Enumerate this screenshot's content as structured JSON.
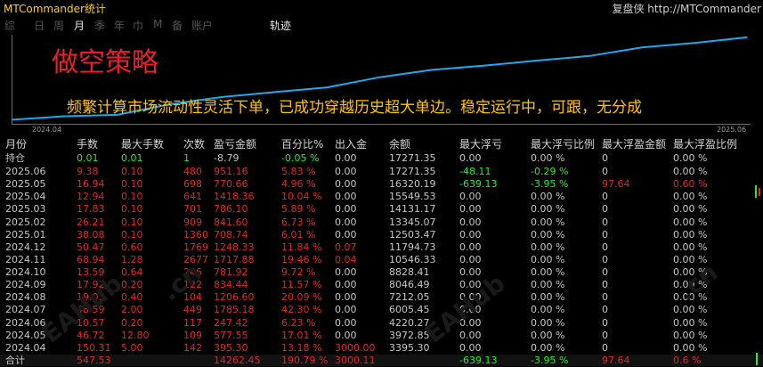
{
  "window": {
    "title": "MTCommander统计",
    "top_right": "复盘侠 http://MTCommander"
  },
  "tabs": [
    {
      "label": "综",
      "active": false
    },
    {
      "label": "日",
      "active": false
    },
    {
      "label": "周",
      "active": false
    },
    {
      "label": "月",
      "active": true
    },
    {
      "label": "季",
      "active": false
    },
    {
      "label": "年",
      "active": false
    },
    {
      "label": "巾",
      "active": false
    },
    {
      "label": "M",
      "active": false
    },
    {
      "label": "备",
      "active": false
    },
    {
      "label": "账户",
      "active": false
    },
    {
      "label": "轨迹",
      "active": true
    }
  ],
  "chart": {
    "heading": "做空策略",
    "subtitle": "频繁计算市场流动性灵活下单，已成功穿越历史超大单边。稳定运行中，可跟，无分成",
    "line_color": "#1ea8ee"
  },
  "chart_data": {
    "type": "line",
    "title": "",
    "x": [
      "2024.04",
      "2024.05",
      "2024.06",
      "2024.07",
      "2024.08",
      "2024.09",
      "2024.10",
      "2024.11",
      "2024.12",
      "2025.01",
      "2025.02",
      "2025.03",
      "2025.04",
      "2025.05",
      "2025.06"
    ],
    "values": [
      3395.3,
      3972.85,
      4220.27,
      6005.45,
      7212.05,
      8046.49,
      8828.41,
      10546.33,
      11794.73,
      12503.47,
      13345.07,
      14131.17,
      15549.53,
      16320.19,
      17271.35
    ],
    "x_ticks": [
      "2024.04",
      "2025.06"
    ],
    "ylim": [
      3000,
      17400
    ],
    "grid": false
  },
  "table": {
    "columns": [
      "月份",
      "手数",
      "最大手数",
      "次数",
      "盈亏金额",
      "百分比%",
      "出入金",
      "余额",
      "最大浮亏",
      "最大浮亏比例",
      "最大浮盈金额",
      "最大浮盈比例"
    ],
    "holding": {
      "period": "持仓",
      "lots": "0.01",
      "max_lots": "0.01",
      "count": "1",
      "pnl": "-8.79",
      "pct": "-0.05 %",
      "flow": "0.00",
      "balance": "17271.35",
      "max_dd": "0.00",
      "max_dd_pct": "0.00 %",
      "max_fp": "0",
      "max_fp_pct": "0.00 %"
    },
    "rows": [
      {
        "period": "2025.06",
        "lots": "9.38",
        "max_lots": "0.10",
        "count": "480",
        "pnl": "951.16",
        "pct": "5.83 %",
        "flow": "0.00",
        "balance": "17271.35",
        "max_dd": "-48.11",
        "max_dd_pct": "-0.29 %",
        "max_fp": "0",
        "max_fp_pct": "0.00 %"
      },
      {
        "period": "2025.05",
        "lots": "16.94",
        "max_lots": "0.10",
        "count": "698",
        "pnl": "770.66",
        "pct": "4.96 %",
        "flow": "0.00",
        "balance": "16320.19",
        "max_dd": "-639.13",
        "max_dd_pct": "-3.95 %",
        "max_fp": "97.64",
        "max_fp_pct": "0.60 %"
      },
      {
        "period": "2025.04",
        "lots": "12.94",
        "max_lots": "0.10",
        "count": "641",
        "pnl": "1418.36",
        "pct": "10.04 %",
        "flow": "0.00",
        "balance": "15549.53",
        "max_dd": "0.00",
        "max_dd_pct": "0.00 %",
        "max_fp": "0",
        "max_fp_pct": "0.00 %"
      },
      {
        "period": "2025.03",
        "lots": "17.83",
        "max_lots": "0.10",
        "count": "701",
        "pnl": "786.10",
        "pct": "5.89 %",
        "flow": "0.00",
        "balance": "14131.17",
        "max_dd": "0.00",
        "max_dd_pct": "0.00 %",
        "max_fp": "0",
        "max_fp_pct": "0.00 %"
      },
      {
        "period": "2025.02",
        "lots": "26.21",
        "max_lots": "0.10",
        "count": "909",
        "pnl": "841.60",
        "pct": "6.73 %",
        "flow": "0.00",
        "balance": "13345.07",
        "max_dd": "0.00",
        "max_dd_pct": "0.00 %",
        "max_fp": "0",
        "max_fp_pct": "0.00 %"
      },
      {
        "period": "2025.01",
        "lots": "38.08",
        "max_lots": "0.10",
        "count": "1360",
        "pnl": "708.74",
        "pct": "6.01 %",
        "flow": "0.00",
        "balance": "12503.47",
        "max_dd": "0.00",
        "max_dd_pct": "0.00 %",
        "max_fp": "0",
        "max_fp_pct": "0.00 %"
      },
      {
        "period": "2024.12",
        "lots": "50.47",
        "max_lots": "0.60",
        "count": "1769",
        "pnl": "1248.33",
        "pct": "11.84 %",
        "flow": "0.07",
        "balance": "11794.73",
        "max_dd": "0.00",
        "max_dd_pct": "0.00 %",
        "max_fp": "0",
        "max_fp_pct": "0.00 %"
      },
      {
        "period": "2024.11",
        "lots": "68.94",
        "max_lots": "1.28",
        "count": "2677",
        "pnl": "1717.88",
        "pct": "19.46 %",
        "flow": "0.04",
        "balance": "10546.33",
        "max_dd": "0.00",
        "max_dd_pct": "0.00 %",
        "max_fp": "0",
        "max_fp_pct": "0.00 %"
      },
      {
        "period": "2024.10",
        "lots": "13.59",
        "max_lots": "0.64",
        "count": "246",
        "pnl": "781.92",
        "pct": "9.72 %",
        "flow": "0.00",
        "balance": "8828.41",
        "max_dd": "0.00",
        "max_dd_pct": "0.00 %",
        "max_fp": "0",
        "max_fp_pct": "0.00 %"
      },
      {
        "period": "2024.09",
        "lots": "17.92",
        "max_lots": "0.20",
        "count": "122",
        "pnl": "834.44",
        "pct": "11.57 %",
        "flow": "0.00",
        "balance": "8046.49",
        "max_dd": "0.00",
        "max_dd_pct": "0.00 %",
        "max_fp": "0",
        "max_fp_pct": "0.00 %"
      },
      {
        "period": "2024.08",
        "lots": "19.03",
        "max_lots": "0.40",
        "count": "104",
        "pnl": "1206.60",
        "pct": "20.09 %",
        "flow": "0.00",
        "balance": "7212.05",
        "max_dd": "0.00",
        "max_dd_pct": "0.00 %",
        "max_fp": "0",
        "max_fp_pct": "0.00 %"
      },
      {
        "period": "2024.07",
        "lots": "48.59",
        "max_lots": "2.00",
        "count": "449",
        "pnl": "1785.18",
        "pct": "42.30 %",
        "flow": "0.00",
        "balance": "6005.45",
        "max_dd": "0.00",
        "max_dd_pct": "0.00 %",
        "max_fp": "0",
        "max_fp_pct": "0.00 %"
      },
      {
        "period": "2024.06",
        "lots": "10.57",
        "max_lots": "0.20",
        "count": "117",
        "pnl": "247.42",
        "pct": "6.23 %",
        "flow": "0.00",
        "balance": "4220.27",
        "max_dd": "0.00",
        "max_dd_pct": "0.00 %",
        "max_fp": "0",
        "max_fp_pct": "0.00 %"
      },
      {
        "period": "2024.05",
        "lots": "46.72",
        "max_lots": "12.80",
        "count": "109",
        "pnl": "577.55",
        "pct": "17.01 %",
        "flow": "0.00",
        "balance": "3972.85",
        "max_dd": "0.00",
        "max_dd_pct": "0.00 %",
        "max_fp": "0",
        "max_fp_pct": "0.00 %"
      },
      {
        "period": "2024.04",
        "lots": "150.31",
        "max_lots": "5.00",
        "count": "142",
        "pnl": "395.30",
        "pct": "13.18 %",
        "flow": "3000.00",
        "balance": "3395.30",
        "max_dd": "0.00",
        "max_dd_pct": "0.00 %",
        "max_fp": "0",
        "max_fp_pct": "0.00 %"
      }
    ],
    "total": {
      "period": "合计",
      "lots": "547.53",
      "max_lots": "",
      "count": "",
      "pnl": "14262.45",
      "pct": "190.79 %",
      "flow": "3000.11",
      "balance": "",
      "max_dd": "-639.13",
      "max_dd_pct": "-3.95 %",
      "max_fp": "97.64",
      "max_fp_pct": "0.6 %"
    }
  },
  "colors": {
    "positive": "#e3242b",
    "negative": "#22ee22",
    "neutral": "#c8c8c8",
    "title": "#ffd400"
  }
}
